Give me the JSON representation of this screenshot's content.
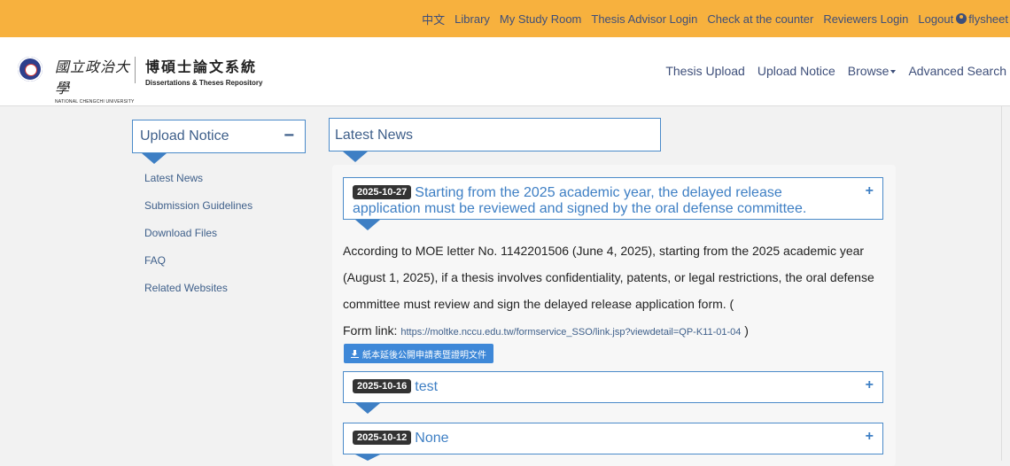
{
  "topbar": {
    "links": [
      "中文",
      "Library",
      "My Study Room",
      "Thesis Advisor Login",
      "Check at the counter",
      "Reviewers Login"
    ],
    "logout_label": "Logout",
    "username": "flysheet",
    "bg_color": "#f7b13e"
  },
  "header": {
    "university_name": "國立政治大學",
    "university_name_en": "NATIONAL CHENGCHI UNIVERSITY",
    "system_name": "博碩士論文系統",
    "system_name_en": "Dissertations & Theses Repository",
    "nav": {
      "thesis_upload": "Thesis Upload",
      "upload_notice": "Upload Notice",
      "browse": "Browse",
      "advanced_search": "Advanced Search"
    }
  },
  "sidebar": {
    "title": "Upload Notice",
    "collapse_symbol": "−",
    "items": [
      "Latest News",
      "Submission Guidelines",
      "Download Files",
      "FAQ",
      "Related Websites"
    ]
  },
  "main": {
    "title": "Latest News",
    "news": [
      {
        "date": "2025-10-27",
        "title": "Starting from the 2025 academic year, the delayed release application must be reviewed and signed by the oral defense committee.",
        "body": "According to MOE letter No. 1142201506 (June 4, 2025), starting from the 2025 academic year (August 1, 2025), if a thesis involves confidentiality, patents, or legal restrictions, the oral defense committee must review and sign the delayed release application form. (",
        "form_label": "Form link:",
        "form_link": "https://moltke.nccu.edu.tw/formservice_SSO/link.jsp?viewdetail=QP-K11-01-04",
        "form_close": ")",
        "download_label": "紙本延後公開申請表暨證明文件"
      },
      {
        "date": "2025-10-16",
        "title": "test"
      },
      {
        "date": "2025-10-12",
        "title": "None"
      }
    ],
    "expand_symbol": "+"
  },
  "colors": {
    "accent": "#3e7fc4",
    "link": "#3e5f8a"
  }
}
